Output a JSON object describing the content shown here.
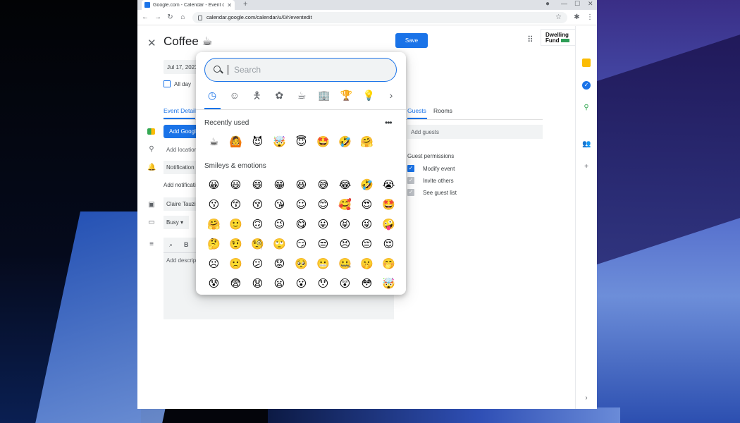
{
  "browser": {
    "tab_title": "Google.com - Calendar - Event d",
    "tab_close": "✕",
    "new_tab": "+",
    "url": "calendar.google.com/calendar/u/0/r/eventedit",
    "nav": {
      "back": "←",
      "forward": "→",
      "reload": "↻",
      "home": "⌂"
    },
    "window": {
      "minimize": "—",
      "maximize": "☐",
      "close": "✕"
    }
  },
  "event": {
    "close": "✕",
    "title": "Coffee ☕",
    "save_label": "Save",
    "date": "Jul 17, 2021",
    "all_day_label": "All day",
    "tab_details": "Event Details",
    "tab_guests": "Guests",
    "tab_rooms": "Rooms",
    "add_meet": "Add Google Meet video conferencing",
    "location_placeholder": "Add location",
    "notification": "Notification",
    "add_notification": "Add notification",
    "owner": "Claire Tauziet",
    "busy": "Busy ▾",
    "desc_placeholder": "Add description"
  },
  "header": {
    "brand_line1": "Dwelling",
    "brand_line2": "Fund"
  },
  "guests": {
    "add_placeholder": "Add guests",
    "permissions_title": "Guest permissions",
    "permissions": [
      {
        "label": "Modify event",
        "checked": true
      },
      {
        "label": "Invite others",
        "checked": false
      },
      {
        "label": "See guest list",
        "checked": false
      }
    ]
  },
  "emoji_picker": {
    "search_placeholder": "Search",
    "categories": [
      "recent",
      "smileys",
      "people",
      "animals",
      "food",
      "travel",
      "activities",
      "objects",
      "more"
    ],
    "sections": {
      "recent": "Recently used",
      "smileys": "Smileys & emotions"
    },
    "recent": [
      "☕",
      "🙆",
      "😈",
      "🤯",
      "😇",
      "🤩",
      "🤣",
      "🤗"
    ],
    "smileys": [
      [
        "😀",
        "😃",
        "😄",
        "😁",
        "😆",
        "😅",
        "😂",
        "🤣",
        "😭"
      ],
      [
        "😗",
        "😙",
        "😚",
        "😘",
        "☺",
        "😊",
        "🥰",
        "😍",
        "🤩"
      ],
      [
        "🤗",
        "🙂",
        "🙃",
        "😉",
        "😋",
        "😛",
        "😝",
        "😜",
        "🤪"
      ],
      [
        "🤔",
        "🤨",
        "🧐",
        "🙄",
        "😏",
        "😒",
        "😣",
        "😔",
        "😌"
      ],
      [
        "☹",
        "🙁",
        "😕",
        "😟",
        "🥺",
        "😬",
        "🤐",
        "🤫",
        "🤭"
      ],
      [
        "😰",
        "😨",
        "😧",
        "😦",
        "😮",
        "😯",
        "😲",
        "😳",
        "🤯"
      ]
    ]
  },
  "colors": {
    "accent": "#1a73e8",
    "save_bg": "#1a73e8"
  }
}
